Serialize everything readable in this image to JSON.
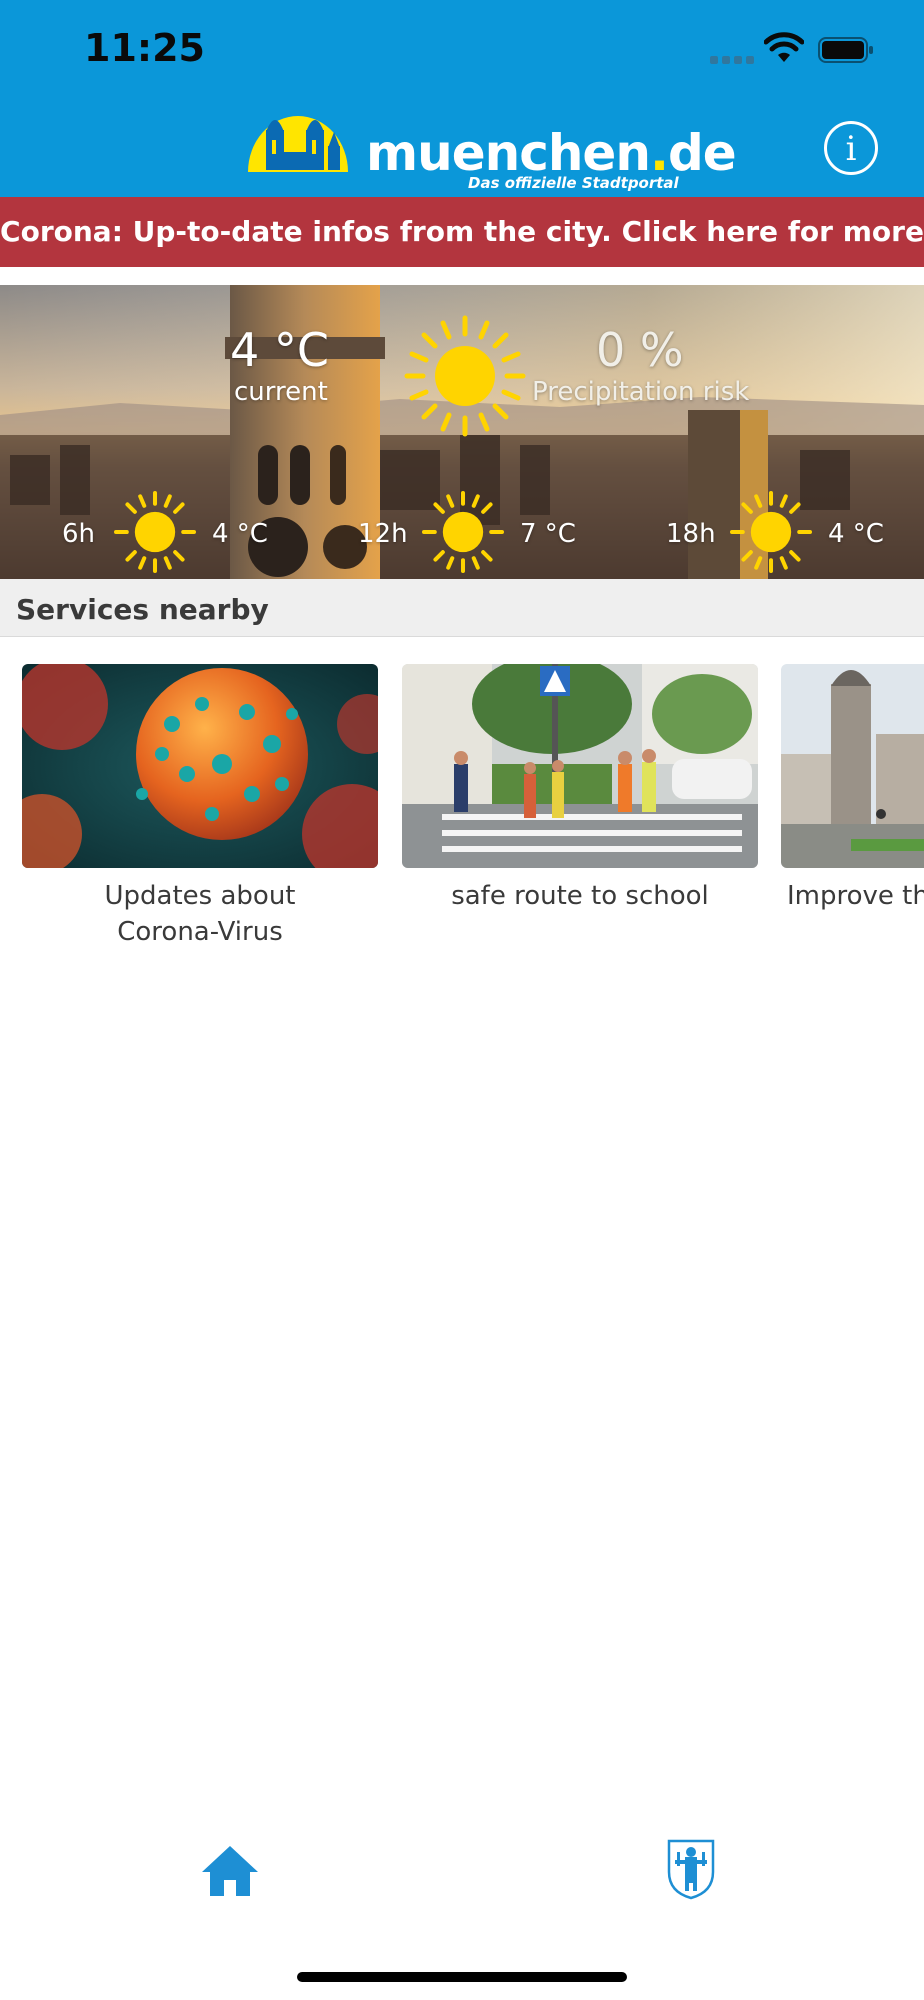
{
  "status_bar": {
    "time": "11:25"
  },
  "header": {
    "logo_word_main": "muenchen",
    "logo_word_dot": ".",
    "logo_word_tld": "de",
    "logo_subtitle": "Das offizielle Stadtportal",
    "info_icon_glyph": "i",
    "brand_color": "#0b97d9"
  },
  "banner": {
    "text": "Corona: Up-to-date infos from the city. Click here for more",
    "color": "#b3353e"
  },
  "weather": {
    "current_temp": "4 °C",
    "current_label": "current",
    "precip_value": "0 %",
    "precip_label": "Precipitation risk",
    "icon": "sun-icon",
    "forecast": [
      {
        "hour": "6h",
        "icon": "sun-icon",
        "temp": "4 °C"
      },
      {
        "hour": "12h",
        "icon": "sun-icon",
        "temp": "7 °C"
      },
      {
        "hour": "18h",
        "icon": "sun-icon",
        "temp": "4 °C"
      }
    ]
  },
  "services": {
    "title": "Services nearby",
    "cards": [
      {
        "label": "Updates about\nCorona-Virus"
      },
      {
        "label": "safe route to school"
      },
      {
        "label": "Improve the"
      }
    ]
  },
  "tabbar": {
    "items": [
      {
        "icon": "home-icon"
      },
      {
        "icon": "city-crest-icon"
      }
    ],
    "active_color": "#1e8fd4"
  }
}
